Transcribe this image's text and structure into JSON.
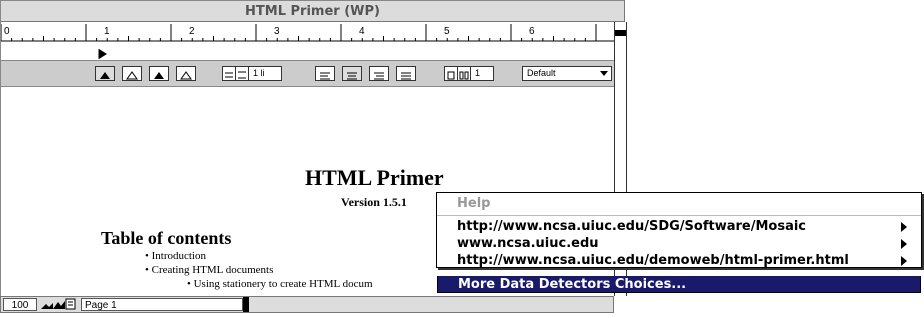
{
  "window": {
    "title": "HTML Primer (WP)"
  },
  "ruler": {
    "numbers": [
      "0",
      "1",
      "2",
      "3",
      "4",
      "5",
      "6"
    ]
  },
  "toolbar": {
    "line_spacing": "1 li",
    "columns": "1",
    "style": "Default"
  },
  "document": {
    "heading": "HTML Primer",
    "version": "Version 1.5.1",
    "toc_heading": "Table of contents",
    "items": [
      "Introduction",
      "Creating HTML documents",
      "Using stationery to create HTML docum"
    ]
  },
  "statusbar": {
    "zoom": "100",
    "page": "Page 1"
  },
  "context_menu": {
    "help": "Help",
    "items": [
      "http://www.ncsa.uiuc.edu/SDG/Software/Mosaic",
      "www.ncsa.uiuc.edu",
      "http://www.ncsa.uiuc.edu/demoweb/html-primer.html"
    ],
    "more": "More Data Detectors Choices..."
  },
  "colors": {
    "menu_highlight": "#1a1a6a",
    "toolbar_bg": "#cccccc"
  }
}
